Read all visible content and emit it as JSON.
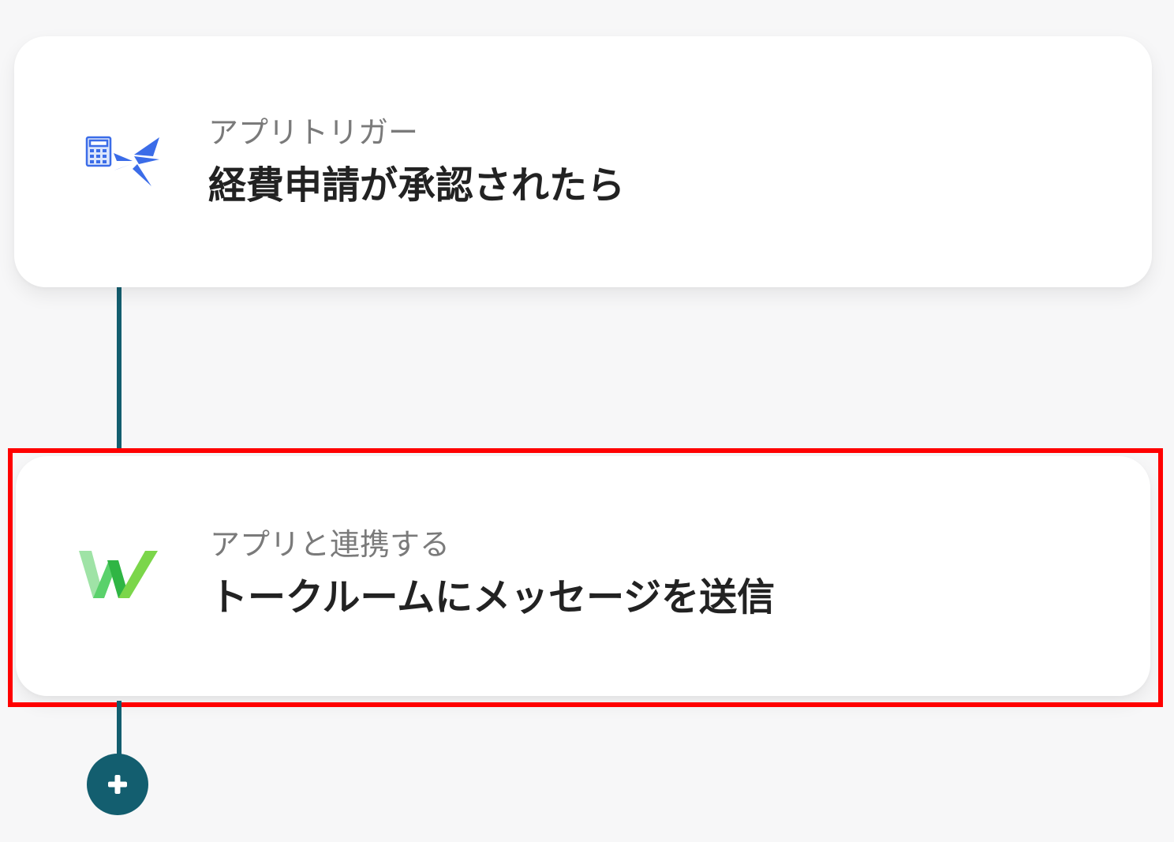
{
  "flow": {
    "steps": [
      {
        "label": "アプリトリガー",
        "title": "経費申請が承認されたら",
        "icon": "calculator-swallow-icon",
        "icon_color": "#3b6ce8",
        "highlighted": false
      },
      {
        "label": "アプリと連携する",
        "title": "トークルームにメッセージを送信",
        "icon": "w-logo-icon",
        "icon_color": "#3cc44a",
        "highlighted": true
      }
    ],
    "add_button_icon": "plus-icon"
  },
  "colors": {
    "connector": "#135e6f",
    "highlight": "#ff0000",
    "background": "#f7f7f8",
    "card": "#ffffff"
  }
}
